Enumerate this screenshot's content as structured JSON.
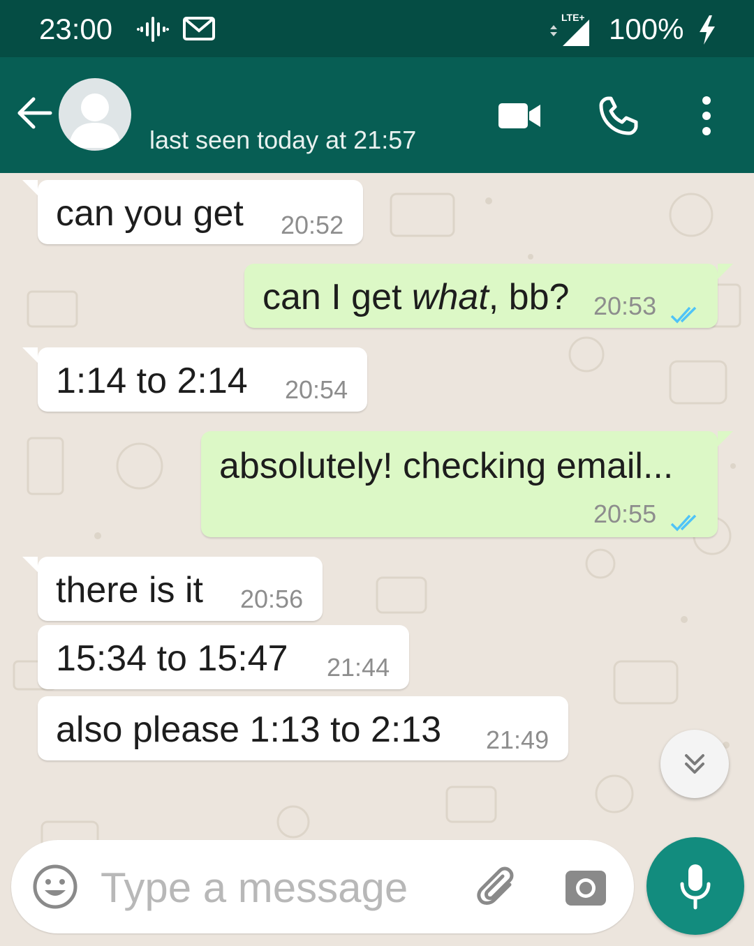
{
  "status_bar": {
    "time": "23:00",
    "network": "LTE+",
    "battery": "100%",
    "icons": [
      "signal-notification-icon",
      "gmail-icon",
      "lte-signal-icon",
      "charging-icon"
    ]
  },
  "header": {
    "last_seen": "last seen today at 21:57",
    "icons": [
      "back-arrow-icon",
      "default-avatar-icon",
      "video-call-icon",
      "voice-call-icon",
      "more-options-icon"
    ],
    "color": "#075e54"
  },
  "messages": [
    {
      "direction": "in",
      "text": "can you get",
      "time": "20:52"
    },
    {
      "direction": "out",
      "text_parts": [
        "can I get ",
        "what",
        ", bb?"
      ],
      "time": "20:53",
      "status": "read"
    },
    {
      "direction": "in",
      "text": "1:14 to 2:14",
      "time": "20:54"
    },
    {
      "direction": "out",
      "text": "absolutely! checking email...",
      "time": "20:55",
      "status": "read"
    },
    {
      "direction": "in",
      "text": "there is it",
      "time": "20:56"
    },
    {
      "direction": "in",
      "text": "15:34 to 15:47",
      "time": "21:44"
    },
    {
      "direction": "in",
      "text": "also please 1:13 to 2:13",
      "time": "21:49"
    }
  ],
  "composer": {
    "placeholder": "Type a message",
    "value": ""
  },
  "colors": {
    "incoming_bubble": "#ffffff",
    "outgoing_bubble": "#dcf8c6",
    "read_ticks": "#4fc3f7",
    "mic_button": "#128c7e"
  }
}
